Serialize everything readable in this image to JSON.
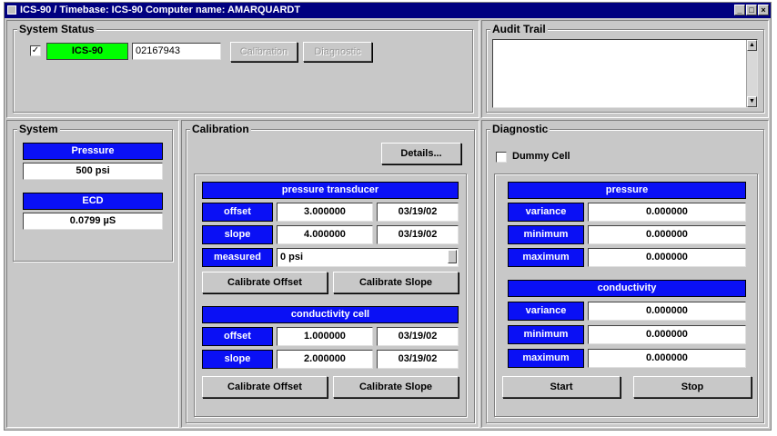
{
  "window": {
    "title": "ICS-90 / Timebase: ICS-90    Computer name: AMARQUARDT",
    "controls": {
      "min": "_",
      "max": "□",
      "close": "×"
    }
  },
  "system_status": {
    "legend": "System Status",
    "checked": "✓",
    "instrument": "ICS-90",
    "serial": "02167943",
    "calibration_label": "Calibration",
    "diagnostic_label": "Diagnostic"
  },
  "audit_trail": {
    "legend": "Audit Trail"
  },
  "system": {
    "legend": "System",
    "pressure_label": "Pressure",
    "pressure_value": "500 psi",
    "ecd_label": "ECD",
    "ecd_value": "0.0799 µS"
  },
  "calibration": {
    "legend": "Calibration",
    "details_label": "Details...",
    "pressure_transducer": {
      "header": "pressure transducer",
      "offset_label": "offset",
      "offset_value": "3.000000",
      "offset_date": "03/19/02",
      "slope_label": "slope",
      "slope_value": "4.000000",
      "slope_date": "03/19/02",
      "measured_label": "measured",
      "measured_value": "0 psi",
      "cal_offset_label": "Calibrate Offset",
      "cal_slope_label": "Calibrate Slope"
    },
    "conductivity_cell": {
      "header": "conductivity cell",
      "offset_label": "offset",
      "offset_value": "1.000000",
      "offset_date": "03/19/02",
      "slope_label": "slope",
      "slope_value": "2.000000",
      "slope_date": "03/19/02",
      "cal_offset_label": "Calibrate Offset",
      "cal_slope_label": "Calibrate Slope"
    }
  },
  "diagnostic": {
    "legend": "Diagnostic",
    "dummy_cell_label": "Dummy Cell",
    "pressure": {
      "header": "pressure",
      "variance_label": "variance",
      "variance_value": "0.000000",
      "minimum_label": "minimum",
      "minimum_value": "0.000000",
      "maximum_label": "maximum",
      "maximum_value": "0.000000"
    },
    "conductivity": {
      "header": "conductivity",
      "variance_label": "variance",
      "variance_value": "0.000000",
      "minimum_label": "minimum",
      "minimum_value": "0.000000",
      "maximum_label": "maximum",
      "maximum_value": "0.000000"
    },
    "start_label": "Start",
    "stop_label": "Stop"
  }
}
